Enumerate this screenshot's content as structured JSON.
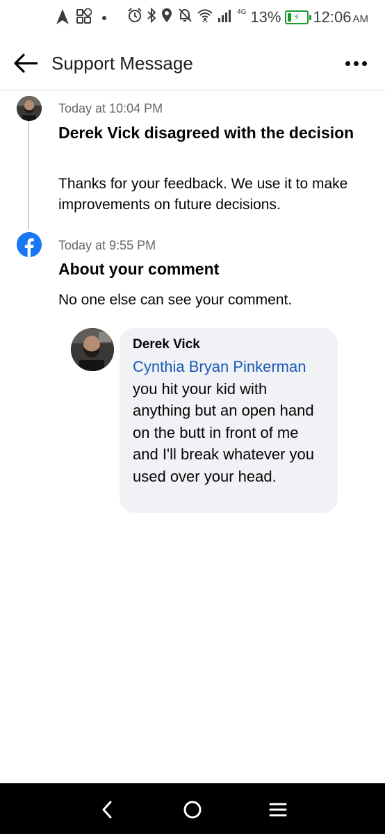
{
  "status_bar": {
    "network_label": "4G",
    "battery_percent": "13%",
    "time": "12:06",
    "ampm": "AM",
    "battery_level": 0.13,
    "battery_color": "#1a9b2e",
    "icons": [
      "navigation-icon",
      "apps-icon",
      "dot-icon",
      "alarm-icon",
      "bluetooth-icon",
      "location-icon",
      "mute-icon",
      "wifi-icon",
      "signal-icon",
      "battery-icon"
    ]
  },
  "header": {
    "title": "Support Message",
    "back_icon": "arrow-left-icon",
    "more_icon": "more-horizontal-icon"
  },
  "timeline": [
    {
      "time": "Today at 10:04 PM",
      "title": "Derek Vick disagreed with the decision",
      "body": "Thanks for your feedback. We use it to make improvements on future decisions.",
      "icon": "user-avatar"
    },
    {
      "time": "Today at 9:55 PM",
      "title": "About your comment",
      "body": "No one else can see your comment.",
      "icon": "facebook-logo-icon"
    }
  ],
  "comment": {
    "author": "Derek Vick",
    "mention": "Cynthia Bryan Pinkerman",
    "text": "you hit your kid with anything but an open hand on the butt in front of me and I'll break whatever you used over your head."
  },
  "colors": {
    "facebook_blue": "#1877f2",
    "mention_blue": "#1a5bb8",
    "bubble_bg": "#f0f2f5",
    "secondary_text": "#65676b"
  },
  "nav": {
    "back_icon": "nav-back-icon",
    "home_icon": "nav-home-icon",
    "menu_icon": "nav-menu-icon"
  }
}
